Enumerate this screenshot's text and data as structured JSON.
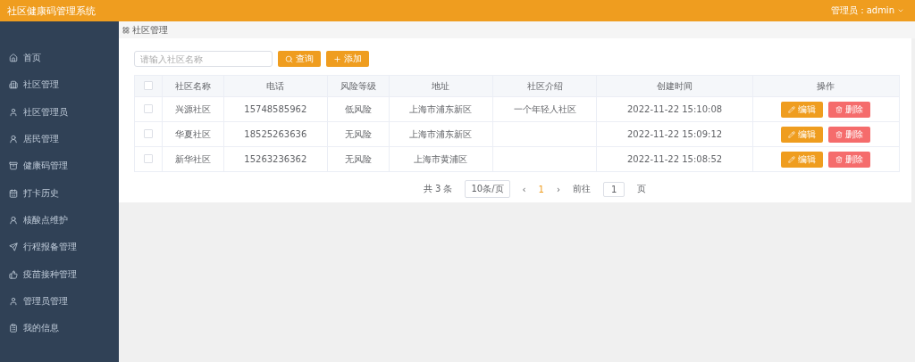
{
  "header": {
    "title": "社区健康码管理系统",
    "user": "管理员：admin"
  },
  "sidebar": {
    "items": [
      {
        "label": "首页"
      },
      {
        "label": "社区管理"
      },
      {
        "label": "社区管理员"
      },
      {
        "label": "居民管理"
      },
      {
        "label": "健康码管理"
      },
      {
        "label": "打卡历史"
      },
      {
        "label": "核酸点维护"
      },
      {
        "label": "行程报备管理"
      },
      {
        "label": "疫苗接种管理"
      },
      {
        "label": "管理员管理"
      },
      {
        "label": "我的信息"
      }
    ]
  },
  "breadcrumb": "社区管理",
  "search": {
    "placeholder": "请输入社区名称",
    "query_button": "查询",
    "add_button": "添加"
  },
  "table": {
    "columns": [
      "社区名称",
      "电话",
      "风险等级",
      "地址",
      "社区介绍",
      "创建时间",
      "操作"
    ],
    "rows": [
      {
        "checked": false,
        "cells": [
          "兴源社区",
          "15748585962",
          "低风险",
          "上海市浦东新区",
          "一个年轻人社区",
          "2022-11-22 15:10:08"
        ],
        "edit": "编辑",
        "delete": "删除"
      },
      {
        "checked": false,
        "cells": [
          "华夏社区",
          "18525263636",
          "无风险",
          "上海市浦东新区",
          "",
          "2022-11-22 15:09:12"
        ],
        "edit": "编辑",
        "delete": "删除"
      },
      {
        "checked": false,
        "cells": [
          "新华社区",
          "15263236362",
          "无风险",
          "上海市黄浦区",
          "",
          "2022-11-22 15:08:52"
        ],
        "edit": "编辑",
        "delete": "删除"
      }
    ],
    "header_checked": false
  },
  "pagination": {
    "total": "共 3 条",
    "page_size": "10条/页",
    "prev": "‹",
    "pages": [
      {
        "label": "1",
        "selected": true
      }
    ],
    "next": "›",
    "goto_label": "前往",
    "goto_value": "1",
    "goto_suffix": "页"
  }
}
